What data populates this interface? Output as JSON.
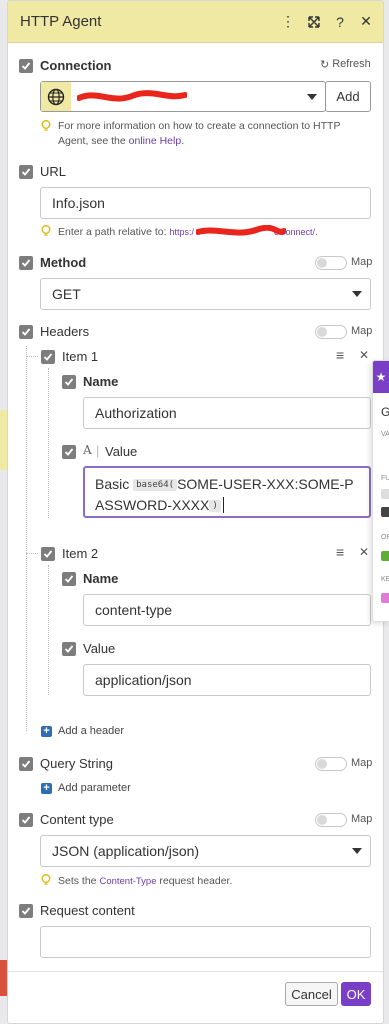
{
  "header": {
    "title": "HTTP Agent"
  },
  "connection": {
    "label": "Connection",
    "refresh_label": "Refresh",
    "add_label": "Add",
    "hint_text": "For more information on how to create a connection to HTTP Agent, see the ",
    "hint_link": "online Help",
    "hint_end": "."
  },
  "url": {
    "label": "URL",
    "value": "Info.json",
    "hint_prefix": "Enter a path relative to: ",
    "hint_link_start": "https:/",
    "hint_link_end": "oConnect/",
    "hint_end": "."
  },
  "method": {
    "label": "Method",
    "map_label": "Map",
    "value": "GET"
  },
  "headers": {
    "label": "Headers",
    "map_label": "Map",
    "items": [
      {
        "title": "Item 1",
        "name_label": "Name",
        "name_value": "Authorization",
        "value_label": "Value",
        "value_prefix": "Basic",
        "func_open": "base64(",
        "value_main": "SOME-USER-XXX:SOME-PASSWORD-XXXX",
        "func_close": ")"
      },
      {
        "title": "Item 2",
        "name_label": "Name",
        "name_value": "content-type",
        "value_label": "Value",
        "value_value": "application/json"
      }
    ],
    "add_label": "Add a header"
  },
  "query_string": {
    "label": "Query String",
    "map_label": "Map",
    "add_label": "Add parameter"
  },
  "content_type": {
    "label": "Content type",
    "map_label": "Map",
    "value": "JSON (application/json)",
    "hint_prefix": "Sets the ",
    "hint_link": "Content-Type",
    "hint_suffix": " request header."
  },
  "request_content": {
    "label": "Request content",
    "value": ""
  },
  "footer": {
    "cancel_label": "Cancel",
    "ok_label": "OK"
  },
  "colors": {
    "header_bg": "#efe9a4",
    "accent": "#6b3fa0",
    "ok_button": "#7a3fc7"
  },
  "side_popup": {
    "letter": "G",
    "lines": [
      "VA",
      "FU",
      "OP",
      "KE"
    ]
  }
}
